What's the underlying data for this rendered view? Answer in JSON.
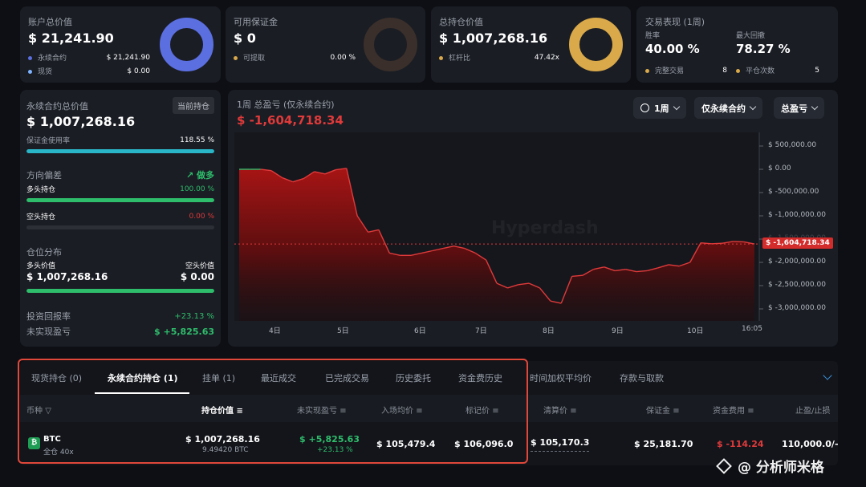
{
  "account": {
    "title": "账户总价值",
    "value": "$ 21,241.90",
    "perp_label": "永续合约",
    "perp_value": "$ 21,241.90",
    "spot_label": "现货",
    "spot_value": "$ 0.00",
    "perp_color": "#5b6fe0",
    "spot_color": "#7fb3ff"
  },
  "margin": {
    "title": "可用保证金",
    "value": "$ 0",
    "withdrawable_label": "可提取",
    "withdrawable_value": "0.00 %"
  },
  "position_total": {
    "title": "总持仓价值",
    "value": "$ 1,007,268.16",
    "leverage_label": "杠杆比",
    "leverage_value": "47.42x",
    "ring_color": "#d9a94a"
  },
  "performance": {
    "title": "交易表现 (1周)",
    "winrate_label": "胜率",
    "winrate_value": "40.00 %",
    "drawdown_label": "最大回撤",
    "drawdown_value": "78.27 %",
    "completed_label": "完整交易",
    "completed_value": "8",
    "closes_label": "平仓次数",
    "closes_value": "5"
  },
  "perp_panel": {
    "title": "永续合约总价值",
    "badge": "当前持仓",
    "value": "$ 1,007,268.16",
    "margin_usage_label": "保证金使用率",
    "margin_usage_value": "118.55 %",
    "margin_usage_fraction": 1.0,
    "bias_label": "方向偏差",
    "bias_value": "做多",
    "long_label": "多头持仓",
    "long_value": "100.00 %",
    "long_fraction": 1.0,
    "short_label": "空头持仓",
    "short_value": "0.00 %",
    "short_fraction": 0.0,
    "dist_label": "仓位分布",
    "long_val_label": "多头价值",
    "short_val_label": "空头价值",
    "long_val": "$ 1,007,268.16",
    "short_val": "$ 0.00",
    "roi_label": "投资回报率",
    "roi_value": "+23.13 %",
    "upnl_label": "未实现盈亏",
    "upnl_value": "$ +5,825.63"
  },
  "pnl_chart": {
    "title": "1周 总盈亏 (仅永续合约)",
    "value": "$ -1,604,718.34",
    "period_label": "1周",
    "filter_label": "仅永续合约",
    "metric_label": "总盈亏",
    "watermark": "Hyperdash"
  },
  "chart_data": {
    "type": "area",
    "x_ticks": [
      "4日",
      "5日",
      "6日",
      "7日",
      "8日",
      "9日",
      "10日",
      "16:05"
    ],
    "y_ticks": [
      "$ 500,000.00",
      "$ 0.00",
      "$ -500,000.00",
      "$ -1,000,000.00",
      "$ -1,500,000.00",
      "$ -2,000,000.00",
      "$ -2,500,000.00",
      "$ -3,000,000.00"
    ],
    "ylim": [
      -3200000,
      600000
    ],
    "current_label": "$ -1,604,718.34",
    "series": [
      {
        "values": [
          0,
          0,
          0,
          -30000,
          -180000,
          -270000,
          -200000,
          -50000,
          -100000,
          -10000,
          20000,
          -1000000,
          -1350000,
          -1300000,
          -1800000,
          -1850000,
          -1850000,
          -1800000,
          -1750000,
          -1700000,
          -1650000,
          -1700000,
          -1800000,
          -1950000,
          -2450000,
          -2550000,
          -2480000,
          -2450000,
          -2550000,
          -2830000,
          -2880000,
          -2300000,
          -2280000,
          -2150000,
          -2100000,
          -2180000,
          -2150000,
          -2200000,
          -2180000,
          -2120000,
          -2050000,
          -2080000,
          -2000000,
          -1580000,
          -1600000,
          -1590000,
          -1550000,
          -1560000,
          -1604718
        ]
      }
    ]
  },
  "tabs": [
    "现货持仓 (0)",
    "永续合约持仓 (1)",
    "挂单 (1)",
    "最近成交",
    "已完成交易",
    "历史委托",
    "资金费历史",
    "时间加权平均价",
    "存款与取款"
  ],
  "table": {
    "headers": {
      "coin": "币种",
      "position_value": "持仓价值",
      "upnl": "未实现盈亏",
      "entry": "入场均价",
      "mark": "标记价",
      "liq": "清算价",
      "margin": "保证金",
      "funding": "资金费用",
      "tp_sl": "止盈/止损"
    },
    "rows": [
      {
        "coin": "BTC",
        "mode": "全仓 40x",
        "position_value": "$ 1,007,268.16",
        "size": "9.49420 BTC",
        "upnl": "$ +5,825.63",
        "upnl_pct": "+23.13 %",
        "entry": "$ 105,479.4",
        "mark": "$ 106,096.0",
        "liq": "$ 105,170.3",
        "margin": "$ 25,181.70",
        "funding": "$ -114.24",
        "tp_sl": "110,000.0/-"
      }
    ]
  },
  "watermark": {
    "text": "@ 分析师米格"
  },
  "colors": {
    "green": "#2ebd6b",
    "red": "#e03a3a",
    "cyan": "#29b6c9",
    "highlight": "#e0483a"
  }
}
